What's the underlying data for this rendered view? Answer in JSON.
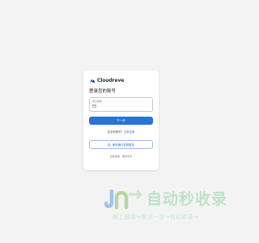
{
  "brand": {
    "name": "Cloudreve",
    "logo_icon": "cloudreve-logo-icon",
    "accent": "#2a73d6"
  },
  "login": {
    "title": "登录您的账号",
    "email_label": "电子邮箱",
    "email_icon": "mail-icon",
    "next_button": "下一步",
    "no_account_text": "还没有账号？",
    "signup_link": "立即注册",
    "passkey_icon": "passkey-icon",
    "passkey_button": "使用通行密钥登录",
    "footer": {
      "privacy": "隐私政策",
      "terms": "服务条款"
    }
  },
  "watermark": {
    "logo_icon": "watermark-logo-icon",
    "title": "自动秒收录",
    "tagline": "做上链接→来访一次→自动收录→"
  }
}
